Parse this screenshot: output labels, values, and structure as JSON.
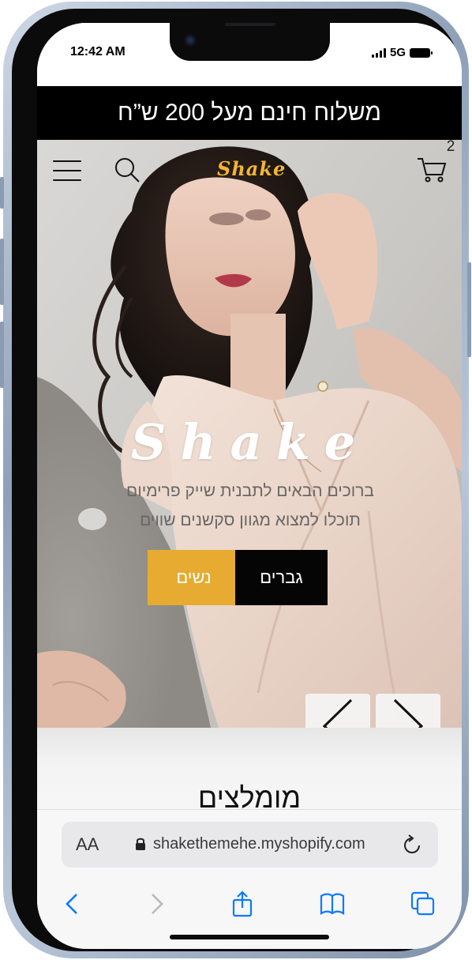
{
  "status": {
    "time": "12:42 AM",
    "network": "5G"
  },
  "announcement": {
    "text": "משלוח חינם מעל 200 ש”ח"
  },
  "header": {
    "logo": "Shake",
    "cart_count": "2",
    "menu_icon": "hamburger-icon",
    "search_icon": "search-icon",
    "cart_icon": "cart-icon"
  },
  "hero": {
    "title": "Shake",
    "subtitle_line1": "ברוכים הבאים לתבנית שייק פרימיום",
    "subtitle_line2": "תוכלו למצוא מגוון סקשנים שווים",
    "buttons": {
      "women": "נשים",
      "men": "גברים"
    },
    "prev_icon": "chevron-left-icon",
    "next_icon": "chevron-right-icon"
  },
  "section": {
    "title": "מומלצים"
  },
  "browser": {
    "aa_label": "AA",
    "url": "shakethemehe.myshopify.com",
    "toolbar": [
      "back-icon",
      "forward-icon",
      "share-icon",
      "bookmarks-icon",
      "tabs-icon"
    ]
  },
  "colors": {
    "accent": "#e6ab30",
    "logo": "#f2b534",
    "announcement_bg": "#000000",
    "ios_blue": "#0a7aff"
  }
}
